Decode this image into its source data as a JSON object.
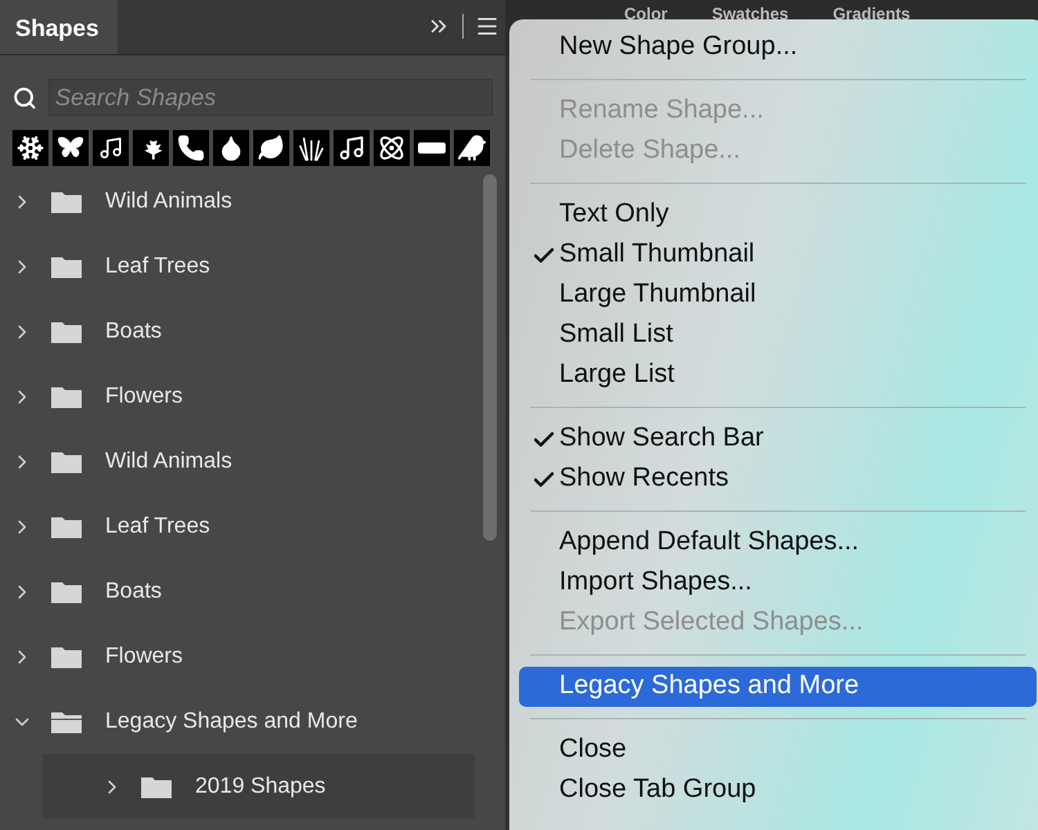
{
  "panel": {
    "title": "Shapes",
    "search": {
      "placeholder": "Search Shapes"
    }
  },
  "back_tabs": [
    {
      "label": "Color"
    },
    {
      "label": "Swatches"
    },
    {
      "label": "Gradients"
    }
  ],
  "tree": [
    {
      "label": "Wild Animals",
      "expanded": false
    },
    {
      "label": "Leaf Trees",
      "expanded": false
    },
    {
      "label": "Boats",
      "expanded": false
    },
    {
      "label": "Flowers",
      "expanded": false
    },
    {
      "label": "Wild Animals",
      "expanded": false
    },
    {
      "label": "Leaf Trees",
      "expanded": false
    },
    {
      "label": "Boats",
      "expanded": false
    },
    {
      "label": "Flowers",
      "expanded": false
    },
    {
      "label": "Legacy Shapes and More",
      "expanded": true,
      "children": [
        {
          "label": "2019 Shapes",
          "expanded": false
        }
      ]
    }
  ],
  "menu": [
    [
      {
        "label": "New Shape Group...",
        "disabled": false,
        "checked": false,
        "selected": false
      }
    ],
    [
      {
        "label": "Rename Shape...",
        "disabled": true,
        "checked": false,
        "selected": false
      },
      {
        "label": "Delete Shape...",
        "disabled": true,
        "checked": false,
        "selected": false
      }
    ],
    [
      {
        "label": "Text Only",
        "disabled": false,
        "checked": false,
        "selected": false
      },
      {
        "label": "Small Thumbnail",
        "disabled": false,
        "checked": true,
        "selected": false
      },
      {
        "label": "Large Thumbnail",
        "disabled": false,
        "checked": false,
        "selected": false
      },
      {
        "label": "Small List",
        "disabled": false,
        "checked": false,
        "selected": false
      },
      {
        "label": "Large List",
        "disabled": false,
        "checked": false,
        "selected": false
      }
    ],
    [
      {
        "label": "Show Search Bar",
        "disabled": false,
        "checked": true,
        "selected": false
      },
      {
        "label": "Show Recents",
        "disabled": false,
        "checked": true,
        "selected": false
      }
    ],
    [
      {
        "label": "Append Default Shapes...",
        "disabled": false,
        "checked": false,
        "selected": false
      },
      {
        "label": "Import Shapes...",
        "disabled": false,
        "checked": false,
        "selected": false
      },
      {
        "label": "Export Selected Shapes...",
        "disabled": true,
        "checked": false,
        "selected": false
      }
    ],
    [
      {
        "label": "Legacy Shapes and More",
        "disabled": false,
        "checked": false,
        "selected": true
      }
    ],
    [
      {
        "label": "Close",
        "disabled": false,
        "checked": false,
        "selected": false
      },
      {
        "label": "Close Tab Group",
        "disabled": false,
        "checked": false,
        "selected": false
      }
    ]
  ]
}
